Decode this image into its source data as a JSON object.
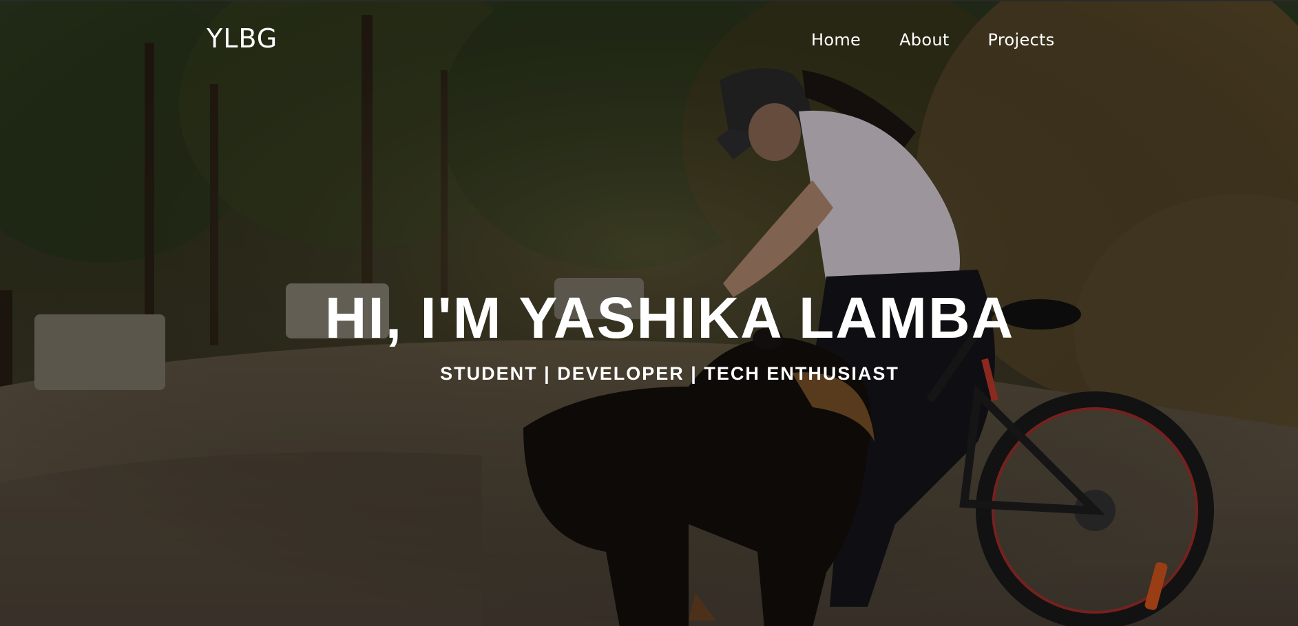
{
  "navbar": {
    "brand": "YLBG",
    "links": [
      {
        "label": "Home"
      },
      {
        "label": "About"
      },
      {
        "label": "Projects"
      }
    ]
  },
  "hero": {
    "title": "HI, I'M YASHIKA LAMBA",
    "subtitle": "STUDENT | DEVELOPER | TECH ENTHUSIAST"
  },
  "theme": {
    "text_color": "#ffffff",
    "overlay_color": "#000000"
  }
}
